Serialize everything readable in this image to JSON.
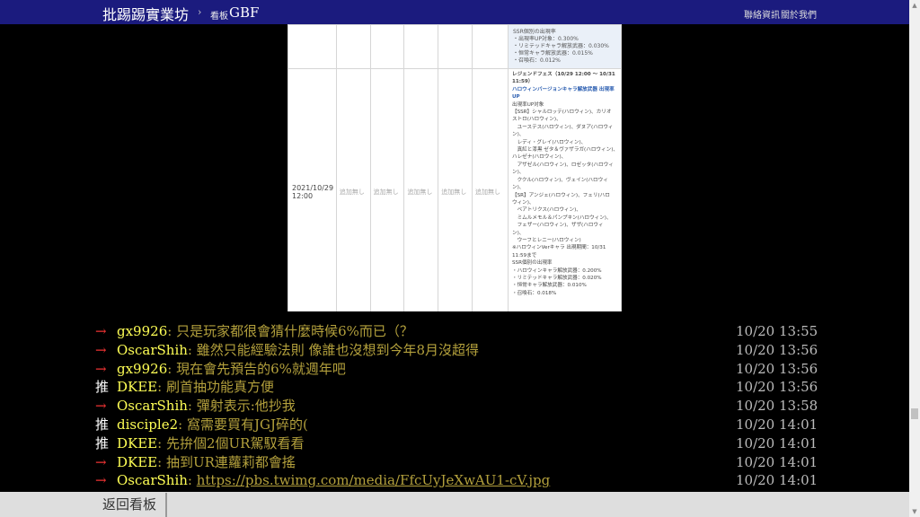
{
  "header": {
    "board_site": "批踢踢實業坊",
    "separator": "›",
    "board_label": "看板",
    "board_name": "GBF",
    "links": [
      "聯絡資訊",
      "關於我們"
    ]
  },
  "embedded_image": {
    "upper_cell_lines": [
      "SSR個別の出現率",
      "・出現率UP対象：0.300%",
      "・リミテッドキャラ解放武器：0.030%",
      "・恒常キャラ解放武器：0.015%",
      "・召喚石：0.012%"
    ],
    "date": [
      "2021/10/29",
      "12:00"
    ],
    "na_label": "追加無し",
    "event_lines": [
      "レジェンドフェス（10/29 12:00 ～ 10/31",
      "11:59）",
      "ハロウィンバージョンキャラ解放武器 出現率",
      "UP",
      "出現率UP対象",
      "【SSR】シャルロッテ(ハロウィン)、カリオ",
      "ストロ(ハロウィン)、",
      "　ユーステス(ハロウィン)、ダヌア(ハロウィ",
      "ン)、",
      "　レディ・グレイ(ハロウィン)、",
      "　真紅と漆黒 ゼタ＆ヴァザラガ(ハロウィン)、",
      "ハレゼナ(ハロウィン)、",
      "　アザゼル(ハロウィン)、ロゼッタ(ハロウィ",
      "ン)、",
      "　ククル(ハロウィン)、ヴェイン(ハロウィ",
      "ン)、",
      "【SR】アンジェ(ハロウィン)、フェリ(ハロ",
      "ウィン)、",
      "　ベアトリクス(ハロウィン)、",
      "　ミムルメモル＆パンプキン(ハロウィン)、",
      "　フェザー(ハロウィン)、ザザ(ハロウィ",
      "ン)、",
      "　ウーフとレニー(ハロウィン)",
      "※ハロウィンVerキャラ 出現期間：10/31",
      "11:59まで",
      "SSR個別の出現率",
      "・ハロウィンキャラ解放武器：0.200%",
      "・リミテッドキャラ解放武器：0.020%",
      "・恒常キャラ解放武器：0.010%",
      "・召喚石：0.018%"
    ]
  },
  "comments": [
    {
      "tag": "→",
      "type": "arrow",
      "user": "gx9926",
      "content": ": 只是玩家都很會猜什麼時候6%而已（？",
      "time": "10/20 13:55"
    },
    {
      "tag": "→",
      "type": "arrow",
      "user": "OscarShih",
      "content": ": 雖然只能經驗法則 像誰也沒想到今年8月沒超得",
      "time": "10/20 13:56"
    },
    {
      "tag": "→",
      "type": "arrow",
      "user": "gx9926",
      "content": ": 現在會先預告的6%就週年吧",
      "time": "10/20 13:56"
    },
    {
      "tag": "推",
      "type": "push",
      "user": "DKEE",
      "content": ": 刷首抽功能真方便",
      "time": "10/20 13:56"
    },
    {
      "tag": "→",
      "type": "arrow",
      "user": "OscarShih",
      "content": ": 彈射表示:他抄我",
      "time": "10/20 13:58"
    },
    {
      "tag": "推",
      "type": "push",
      "user": "disciple2",
      "content": ": 窩需要買有JGJ碎的(",
      "time": "10/20 14:01"
    },
    {
      "tag": "推",
      "type": "push",
      "user": "DKEE",
      "content": ": 先拚個2個UR駕馭看看",
      "time": "10/20 14:01"
    },
    {
      "tag": "→",
      "type": "arrow",
      "user": "DKEE",
      "content": ": 抽到UR連蘿莉都會搖",
      "time": "10/20 14:01"
    },
    {
      "tag": "→",
      "type": "arrow",
      "user": "OscarShih",
      "content": ": ",
      "link": "https://pbs.twimg.com/media/FfcUyJeXwAU1-cV.jpg",
      "time": "10/20 14:01"
    }
  ],
  "footer": {
    "back_label": "返回看板"
  },
  "colors": {
    "topbar": "#1b1b7e",
    "arrow_tag": "#ee3333",
    "username": "#ffff55",
    "content": "#b3a03c"
  }
}
